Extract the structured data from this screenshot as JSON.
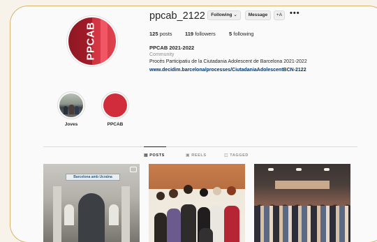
{
  "profile": {
    "username": "ppcab_2122",
    "following_button": "Following",
    "following_caret": "⌄",
    "message_button": "Message",
    "suggest_icon": "+A",
    "more_icon": "•••",
    "avatar_text": "PPCAB"
  },
  "stats": {
    "posts_count": "125",
    "posts_label": "posts",
    "followers_count": "119",
    "followers_label": "followers",
    "following_count": "5",
    "following_label": "following"
  },
  "bio": {
    "name": "PPCAB 2021-2022",
    "category": "Community",
    "description": "Procés Participatiu de la Ciutadania Adolescent de Barcelona 2021-2022",
    "link": "www.decidim.barcelona/processes/CiutadaniaAdolescentBCN-2122"
  },
  "highlights": [
    {
      "label": "Joves"
    },
    {
      "label": "PPCAB"
    }
  ],
  "tabs": {
    "posts": "POSTS",
    "reels": "REELS",
    "tagged": "TAGGED",
    "posts_icon": "▦",
    "reels_icon": "▣",
    "tagged_icon": "◫"
  },
  "posts": {
    "post1_sign": "Barcelona amb Ucraïna"
  },
  "colors": {
    "accent_red": "#d02c3b",
    "link_blue": "#00376b",
    "frame_gold": "#d9b56b"
  }
}
